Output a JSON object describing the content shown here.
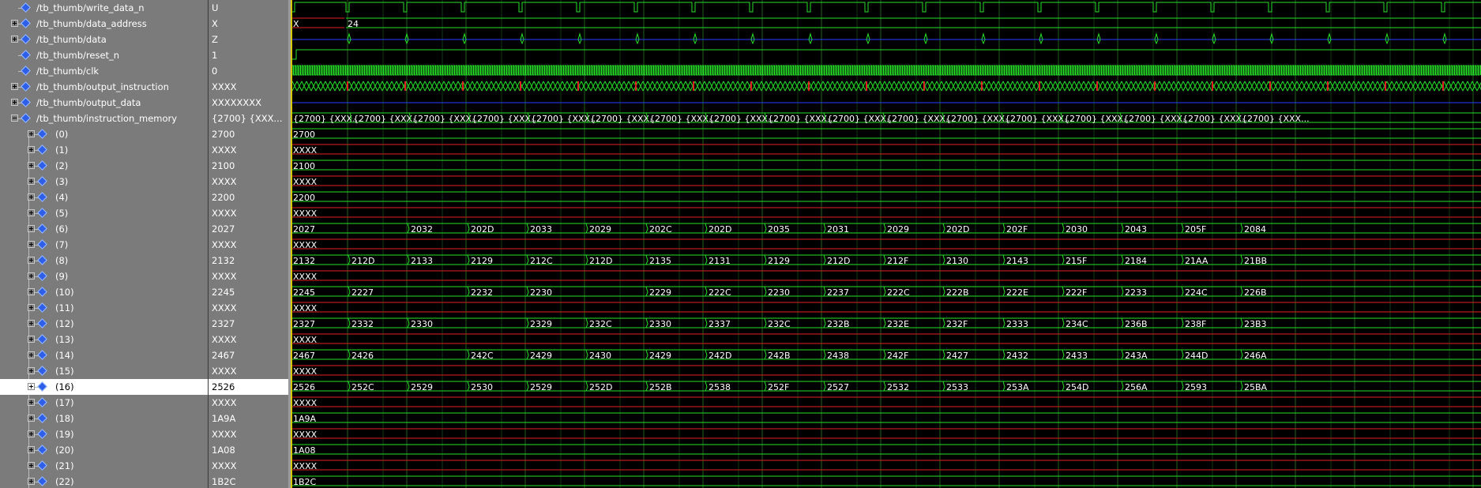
{
  "colors": {
    "panel_bg": "#7b7b7b",
    "wave_bg": "#000000",
    "grid": "#1f5f1f",
    "wave_green": "#28e028",
    "wave_blue": "#2e3cff",
    "wave_red": "#e02020",
    "cursor": "#d8c800",
    "selected_row": "#ffffff"
  },
  "signals": [
    {
      "name": "/tb_thumb/write_data_n",
      "value": "U",
      "indent": 0,
      "expander": "none",
      "wave": "write_n"
    },
    {
      "name": "/tb_thumb/data_address",
      "value": "X",
      "indent": 0,
      "expander": "plus",
      "wave": "address",
      "labels": [
        {
          "t": 0,
          "text": "X"
        },
        {
          "t": 68,
          "text": "24"
        }
      ]
    },
    {
      "name": "/tb_thumb/data",
      "value": "Z",
      "indent": 0,
      "expander": "plus",
      "wave": "data"
    },
    {
      "name": "/tb_thumb/reset_n",
      "value": "1",
      "indent": 0,
      "expander": "none",
      "wave": "reset"
    },
    {
      "name": "/tb_thumb/clk",
      "value": "0",
      "indent": 0,
      "expander": "none",
      "wave": "clk"
    },
    {
      "name": "/tb_thumb/output_instruction",
      "value": "XXXX",
      "indent": 0,
      "expander": "plus",
      "wave": "instr"
    },
    {
      "name": "/tb_thumb/output_data",
      "value": "XXXXXXXX",
      "indent": 0,
      "expander": "plus",
      "wave": "outdata"
    },
    {
      "name": "/tb_thumb/instruction_memory",
      "value": "{2700} {XXX...",
      "indent": 0,
      "expander": "minus",
      "wave": "mem",
      "labels": [
        {
          "t": 0,
          "text": "{2700} {XXX..."
        },
        {
          "t": 75,
          "text": "{2700} {XXX..."
        },
        {
          "t": 150,
          "text": "{2700} {XXX..."
        },
        {
          "t": 225,
          "text": "{2700} {XXX..."
        },
        {
          "t": 300,
          "text": "{2700} {XXX..."
        },
        {
          "t": 375,
          "text": "{2700} {XXX..."
        },
        {
          "t": 450,
          "text": "{2700} {XXX..."
        },
        {
          "t": 525,
          "text": "{2700} {XXX..."
        },
        {
          "t": 600,
          "text": "{2700} {XXX..."
        },
        {
          "t": 675,
          "text": "{2700} {XXX..."
        },
        {
          "t": 750,
          "text": "{2700} {XXX..."
        },
        {
          "t": 825,
          "text": "{2700} {XXX..."
        },
        {
          "t": 900,
          "text": "{2700} {XXX..."
        },
        {
          "t": 975,
          "text": "{2700} {XXX..."
        },
        {
          "t": 1050,
          "text": "{2700} {XXX..."
        },
        {
          "t": 1125,
          "text": "{2700} {XXX..."
        },
        {
          "t": 1200,
          "text": "{2700} {XXX..."
        }
      ]
    },
    {
      "name": "(0)",
      "value": "2700",
      "indent": 1,
      "expander": "plus",
      "wave": "bus",
      "labels": [
        {
          "t": 0,
          "text": "2700"
        }
      ]
    },
    {
      "name": "(1)",
      "value": "XXXX",
      "indent": 1,
      "expander": "plus",
      "wave": "bus_x",
      "labels": [
        {
          "t": 0,
          "text": "XXXX"
        }
      ]
    },
    {
      "name": "(2)",
      "value": "2100",
      "indent": 1,
      "expander": "plus",
      "wave": "bus",
      "labels": [
        {
          "t": 0,
          "text": "2100"
        }
      ]
    },
    {
      "name": "(3)",
      "value": "XXXX",
      "indent": 1,
      "expander": "plus",
      "wave": "bus_x",
      "labels": [
        {
          "t": 0,
          "text": "XXXX"
        }
      ]
    },
    {
      "name": "(4)",
      "value": "2200",
      "indent": 1,
      "expander": "plus",
      "wave": "bus",
      "labels": [
        {
          "t": 0,
          "text": "2200"
        }
      ]
    },
    {
      "name": "(5)",
      "value": "XXXX",
      "indent": 1,
      "expander": "plus",
      "wave": "bus_x",
      "labels": [
        {
          "t": 0,
          "text": "XXXX"
        }
      ]
    },
    {
      "name": "(6)",
      "value": "2027",
      "indent": 1,
      "expander": "plus",
      "wave": "bus",
      "labels": [
        {
          "t": 0,
          "text": "2027"
        },
        {
          "t": 148,
          "text": "2032"
        },
        {
          "t": 224,
          "text": "202D"
        },
        {
          "t": 299,
          "text": "2033"
        },
        {
          "t": 374,
          "text": "2029"
        },
        {
          "t": 450,
          "text": "202C"
        },
        {
          "t": 525,
          "text": "202D"
        },
        {
          "t": 600,
          "text": "2035"
        },
        {
          "t": 675,
          "text": "2031"
        },
        {
          "t": 751,
          "text": "2029"
        },
        {
          "t": 826,
          "text": "202D"
        },
        {
          "t": 902,
          "text": "202F"
        },
        {
          "t": 977,
          "text": "2030"
        },
        {
          "t": 1052,
          "text": "2043"
        },
        {
          "t": 1128,
          "text": "205F"
        },
        {
          "t": 1203,
          "text": "2084"
        }
      ]
    },
    {
      "name": "(7)",
      "value": "XXXX",
      "indent": 1,
      "expander": "plus",
      "wave": "bus_x",
      "labels": [
        {
          "t": 0,
          "text": "XXXX"
        }
      ]
    },
    {
      "name": "(8)",
      "value": "2132",
      "indent": 1,
      "expander": "plus",
      "wave": "bus",
      "labels": [
        {
          "t": 0,
          "text": "2132"
        },
        {
          "t": 73,
          "text": "212D"
        },
        {
          "t": 148,
          "text": "2133"
        },
        {
          "t": 224,
          "text": "2129"
        },
        {
          "t": 299,
          "text": "212C"
        },
        {
          "t": 374,
          "text": "212D"
        },
        {
          "t": 450,
          "text": "2135"
        },
        {
          "t": 525,
          "text": "2131"
        },
        {
          "t": 600,
          "text": "2129"
        },
        {
          "t": 675,
          "text": "212D"
        },
        {
          "t": 751,
          "text": "212F"
        },
        {
          "t": 826,
          "text": "2130"
        },
        {
          "t": 902,
          "text": "2143"
        },
        {
          "t": 977,
          "text": "215F"
        },
        {
          "t": 1052,
          "text": "2184"
        },
        {
          "t": 1128,
          "text": "21AA"
        },
        {
          "t": 1203,
          "text": "21BB"
        }
      ]
    },
    {
      "name": "(9)",
      "value": "XXXX",
      "indent": 1,
      "expander": "plus",
      "wave": "bus_x",
      "labels": [
        {
          "t": 0,
          "text": "XXXX"
        }
      ]
    },
    {
      "name": "(10)",
      "value": "2245",
      "indent": 1,
      "expander": "plus",
      "wave": "bus",
      "labels": [
        {
          "t": 0,
          "text": "2245"
        },
        {
          "t": 73,
          "text": "2227"
        },
        {
          "t": 224,
          "text": "2232"
        },
        {
          "t": 299,
          "text": "2230"
        },
        {
          "t": 450,
          "text": "2229"
        },
        {
          "t": 525,
          "text": "222C"
        },
        {
          "t": 600,
          "text": "2230"
        },
        {
          "t": 675,
          "text": "2237"
        },
        {
          "t": 751,
          "text": "222C"
        },
        {
          "t": 826,
          "text": "222B"
        },
        {
          "t": 902,
          "text": "222E"
        },
        {
          "t": 977,
          "text": "222F"
        },
        {
          "t": 1052,
          "text": "2233"
        },
        {
          "t": 1128,
          "text": "224C"
        },
        {
          "t": 1203,
          "text": "226B"
        }
      ]
    },
    {
      "name": "(11)",
      "value": "XXXX",
      "indent": 1,
      "expander": "plus",
      "wave": "bus_x",
      "labels": [
        {
          "t": 0,
          "text": "XXXX"
        }
      ]
    },
    {
      "name": "(12)",
      "value": "2327",
      "indent": 1,
      "expander": "plus",
      "wave": "bus",
      "labels": [
        {
          "t": 0,
          "text": "2327"
        },
        {
          "t": 73,
          "text": "2332"
        },
        {
          "t": 148,
          "text": "2330"
        },
        {
          "t": 299,
          "text": "2329"
        },
        {
          "t": 374,
          "text": "232C"
        },
        {
          "t": 450,
          "text": "2330"
        },
        {
          "t": 525,
          "text": "2337"
        },
        {
          "t": 600,
          "text": "232C"
        },
        {
          "t": 675,
          "text": "232B"
        },
        {
          "t": 751,
          "text": "232E"
        },
        {
          "t": 826,
          "text": "232F"
        },
        {
          "t": 902,
          "text": "2333"
        },
        {
          "t": 977,
          "text": "234C"
        },
        {
          "t": 1052,
          "text": "236B"
        },
        {
          "t": 1128,
          "text": "238F"
        },
        {
          "t": 1203,
          "text": "23B3"
        }
      ]
    },
    {
      "name": "(13)",
      "value": "XXXX",
      "indent": 1,
      "expander": "plus",
      "wave": "bus_x",
      "labels": [
        {
          "t": 0,
          "text": "XXXX"
        }
      ]
    },
    {
      "name": "(14)",
      "value": "2467",
      "indent": 1,
      "expander": "plus",
      "wave": "bus",
      "labels": [
        {
          "t": 0,
          "text": "2467"
        },
        {
          "t": 73,
          "text": "2426"
        },
        {
          "t": 224,
          "text": "242C"
        },
        {
          "t": 299,
          "text": "2429"
        },
        {
          "t": 374,
          "text": "2430"
        },
        {
          "t": 450,
          "text": "2429"
        },
        {
          "t": 525,
          "text": "242D"
        },
        {
          "t": 600,
          "text": "242B"
        },
        {
          "t": 675,
          "text": "2438"
        },
        {
          "t": 751,
          "text": "242F"
        },
        {
          "t": 826,
          "text": "2427"
        },
        {
          "t": 902,
          "text": "2432"
        },
        {
          "t": 977,
          "text": "2433"
        },
        {
          "t": 1052,
          "text": "243A"
        },
        {
          "t": 1128,
          "text": "244D"
        },
        {
          "t": 1203,
          "text": "246A"
        }
      ]
    },
    {
      "name": "(15)",
      "value": "XXXX",
      "indent": 1,
      "expander": "plus",
      "wave": "bus_x",
      "labels": [
        {
          "t": 0,
          "text": "XXXX"
        }
      ]
    },
    {
      "name": "(16)",
      "value": "2526",
      "indent": 1,
      "expander": "plus",
      "wave": "bus",
      "selected": true,
      "labels": [
        {
          "t": 0,
          "text": "2526"
        },
        {
          "t": 73,
          "text": "252C"
        },
        {
          "t": 148,
          "text": "2529"
        },
        {
          "t": 224,
          "text": "2530"
        },
        {
          "t": 299,
          "text": "2529"
        },
        {
          "t": 374,
          "text": "252D"
        },
        {
          "t": 450,
          "text": "252B"
        },
        {
          "t": 525,
          "text": "2538"
        },
        {
          "t": 600,
          "text": "252F"
        },
        {
          "t": 675,
          "text": "2527"
        },
        {
          "t": 751,
          "text": "2532"
        },
        {
          "t": 826,
          "text": "2533"
        },
        {
          "t": 902,
          "text": "253A"
        },
        {
          "t": 977,
          "text": "254D"
        },
        {
          "t": 1052,
          "text": "256A"
        },
        {
          "t": 1128,
          "text": "2593"
        },
        {
          "t": 1203,
          "text": "25BA"
        }
      ]
    },
    {
      "name": "(17)",
      "value": "XXXX",
      "indent": 1,
      "expander": "plus",
      "wave": "bus_x",
      "labels": [
        {
          "t": 0,
          "text": "XXXX"
        }
      ]
    },
    {
      "name": "(18)",
      "value": "1A9A",
      "indent": 1,
      "expander": "plus",
      "wave": "bus",
      "labels": [
        {
          "t": 0,
          "text": "1A9A"
        }
      ]
    },
    {
      "name": "(19)",
      "value": "XXXX",
      "indent": 1,
      "expander": "plus",
      "wave": "bus_x",
      "labels": [
        {
          "t": 0,
          "text": "XXXX"
        }
      ]
    },
    {
      "name": "(20)",
      "value": "1A08",
      "indent": 1,
      "expander": "plus",
      "wave": "bus",
      "labels": [
        {
          "t": 0,
          "text": "1A08"
        }
      ]
    },
    {
      "name": "(21)",
      "value": "XXXX",
      "indent": 1,
      "expander": "plus",
      "wave": "bus_x",
      "labels": [
        {
          "t": 0,
          "text": "XXXX"
        }
      ]
    },
    {
      "name": "(22)",
      "value": "1B2C",
      "indent": 1,
      "expander": "plus",
      "wave": "bus",
      "labels": [
        {
          "t": 0,
          "text": "1B2C"
        }
      ]
    }
  ]
}
